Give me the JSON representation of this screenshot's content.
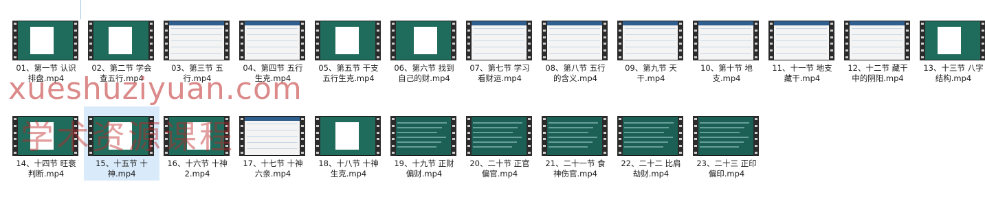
{
  "files_row1": [
    {
      "name": "01、第一节 认识\n排盘.mp4",
      "style": "teal"
    },
    {
      "name": "02、第二节 学会\n查五行.mp4",
      "style": "teal"
    },
    {
      "name": "03、第三节 五\n行.mp4",
      "style": "white"
    },
    {
      "name": "04、第四节 五行\n生克.mp4",
      "style": "white"
    },
    {
      "name": "05、第五节 干支\n五行生克.mp4",
      "style": "teal"
    },
    {
      "name": "06、第六节 找到\n自己的财.mp4",
      "style": "teal"
    },
    {
      "name": "07、第七节 学习\n看财运.mp4",
      "style": "white"
    },
    {
      "name": "08、第八节 五行\n的含义.mp4",
      "style": "white"
    },
    {
      "name": "09、第九节 天\n干.mp4",
      "style": "white"
    },
    {
      "name": "10、第十节 地\n支.mp4",
      "style": "white"
    },
    {
      "name": "11、十一节 地支\n藏干.mp4",
      "style": "white"
    },
    {
      "name": "12、十二节 藏干\n中的阴阳.mp4",
      "style": "white"
    },
    {
      "name": "13、十三节 八字\n结构.mp4",
      "style": "teal"
    }
  ],
  "files_row2": [
    {
      "name": "14、十四节 旺衰\n判断.mp4",
      "style": "teal"
    },
    {
      "name": "15、十五节 十\n神.mp4",
      "style": "teal",
      "selected": true
    },
    {
      "name": "16、十六节 十神\n2.mp4",
      "style": "teal"
    },
    {
      "name": "17、十七节 十神\n六亲.mp4",
      "style": "white"
    },
    {
      "name": "18、十八节 十神\n生克.mp4",
      "style": "teal"
    },
    {
      "name": "19、十九节 正财\n偏财.mp4",
      "style": "teal2"
    },
    {
      "name": "20、二十节 正官\n偏官.mp4",
      "style": "teal2"
    },
    {
      "name": "21、二十一节 食\n神伤官.mp4",
      "style": "teal2"
    },
    {
      "name": "22、二十二 比肩\n劫财.mp4",
      "style": "teal2"
    },
    {
      "name": "23、二十三 正印\n偏印.mp4",
      "style": "teal2"
    }
  ],
  "watermark": {
    "line1": "xueshuziyuan.com",
    "line2": "学术资源课程"
  },
  "colors": {
    "teal": "#1f6b5c",
    "selection": "#d9ebfa",
    "watermark": "#be2828"
  }
}
